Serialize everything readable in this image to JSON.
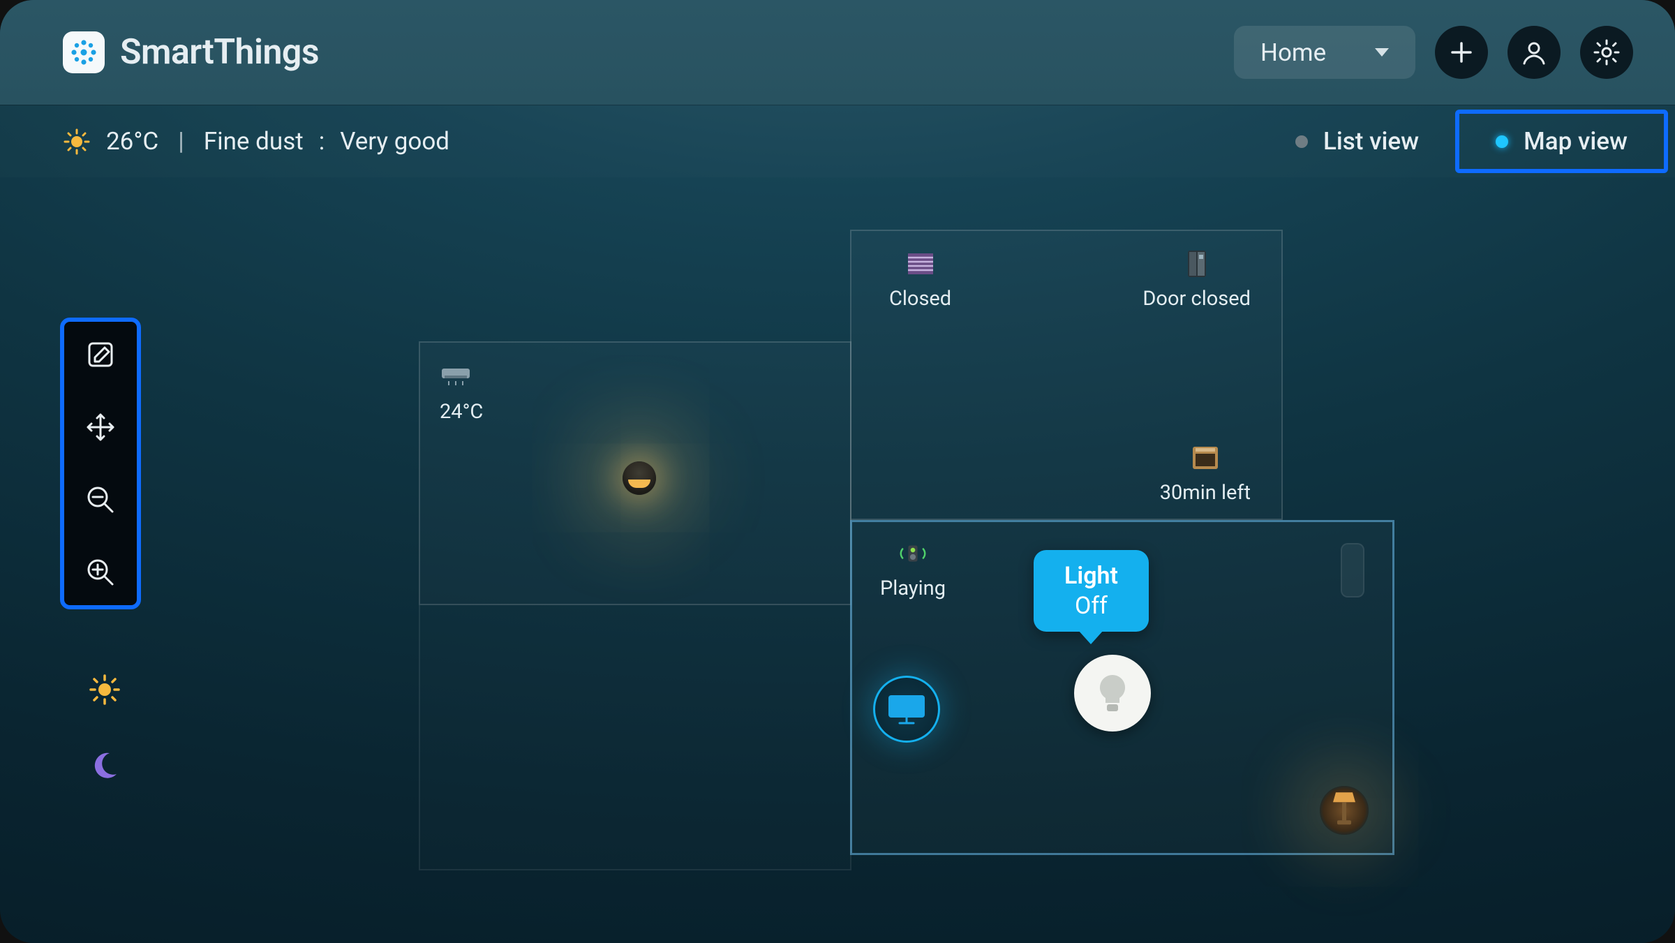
{
  "app": {
    "name": "SmartThings"
  },
  "header": {
    "location_select": "Home",
    "icons": {
      "add": "plus-icon",
      "profile": "person-icon",
      "settings": "gear-icon"
    }
  },
  "weather": {
    "temperature": "26°C",
    "air_label": "Fine dust",
    "air_value": "Very good"
  },
  "views": {
    "list_label": "List view",
    "map_label": "Map view",
    "active": "map"
  },
  "toolbar": {
    "items": [
      {
        "name": "edit",
        "icon": "edit-icon"
      },
      {
        "name": "move",
        "icon": "move-icon"
      },
      {
        "name": "zoom_out",
        "icon": "zoom-out-icon"
      },
      {
        "name": "zoom_in",
        "icon": "zoom-in-icon"
      }
    ]
  },
  "theme_toggles": {
    "day": "sun-icon",
    "night": "moon-icon"
  },
  "rooms": [
    {
      "id": "room-left",
      "devices": {
        "ac": {
          "label": "24°C"
        }
      }
    },
    {
      "id": "room-top-right",
      "devices": {
        "blinds": {
          "label": "Closed"
        },
        "fridge": {
          "label": "Door closed"
        },
        "oven": {
          "label": "30min left"
        }
      }
    },
    {
      "id": "room-bottom-right",
      "devices": {
        "speaker": {
          "label": "Playing"
        },
        "tv": {},
        "light": {
          "tooltip_l1": "Light",
          "tooltip_l2": "Off"
        },
        "battery": {},
        "lamp": {}
      }
    }
  ]
}
